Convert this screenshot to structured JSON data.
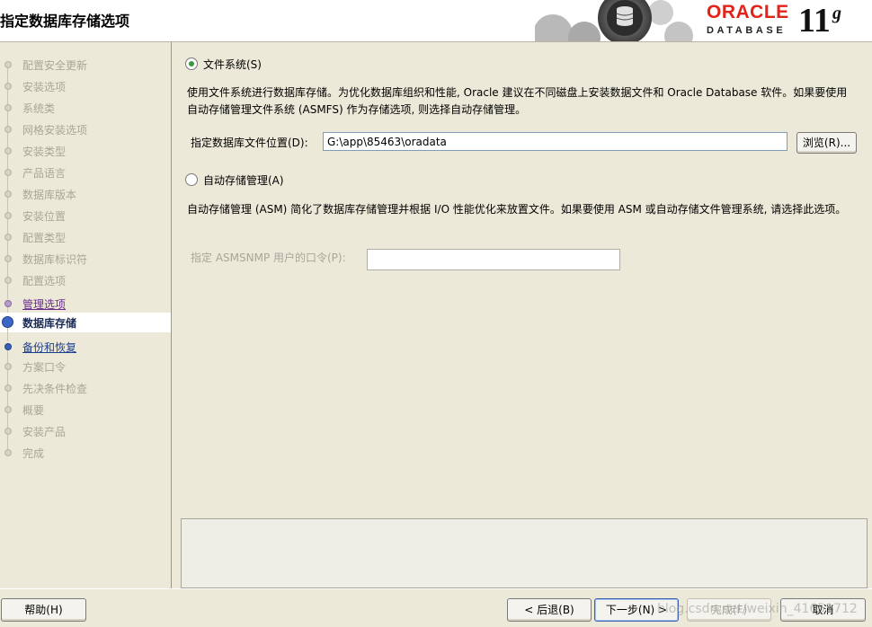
{
  "header": {
    "title": "指定数据库存储选项",
    "logo_oracle": "ORACLE",
    "logo_database": "DATABASE",
    "logo_version": "11",
    "logo_version_sup": "g"
  },
  "nav": {
    "items": [
      {
        "label": "配置安全更新",
        "state": "disabled"
      },
      {
        "label": "安装选项",
        "state": "disabled"
      },
      {
        "label": "系统类",
        "state": "disabled"
      },
      {
        "label": "网格安装选项",
        "state": "disabled"
      },
      {
        "label": "安装类型",
        "state": "disabled"
      },
      {
        "label": "产品语言",
        "state": "disabled"
      },
      {
        "label": "数据库版本",
        "state": "disabled"
      },
      {
        "label": "安装位置",
        "state": "disabled"
      },
      {
        "label": "配置类型",
        "state": "disabled"
      },
      {
        "label": "数据库标识符",
        "state": "disabled"
      },
      {
        "label": "配置选项",
        "state": "disabled"
      },
      {
        "label": "管理选项",
        "state": "visited"
      },
      {
        "label": "数据库存储",
        "state": "current"
      },
      {
        "label": "备份和恢复",
        "state": "link"
      },
      {
        "label": "方案口令",
        "state": "disabled"
      },
      {
        "label": "先决条件检查",
        "state": "disabled"
      },
      {
        "label": "概要",
        "state": "disabled"
      },
      {
        "label": "安装产品",
        "state": "disabled"
      },
      {
        "label": "完成",
        "state": "disabled"
      }
    ]
  },
  "main": {
    "fs_option": {
      "label": "文件系统(S)",
      "checked": true,
      "description": "使用文件系统进行数据库存储。为优化数据库组织和性能, Oracle 建议在不同磁盘上安装数据文件和 Oracle Database 软件。如果要使用自动存储管理文件系统 (ASMFS) 作为存储选项, 则选择自动存储管理。",
      "location_label": "指定数据库文件位置(D):",
      "location_value": "G:\\app\\85463\\oradata",
      "browse_label": "浏览(R)..."
    },
    "asm_option": {
      "label": "自动存储管理(A)",
      "checked": false,
      "description": "自动存储管理 (ASM) 简化了数据库存储管理并根据 I/O 性能优化来放置文件。如果要使用 ASM 或自动存储文件管理系统, 请选择此选项。",
      "password_label": "指定 ASMSNMP 用户的口令(P):",
      "password_value": ""
    }
  },
  "footer": {
    "help_label": "帮助(H)",
    "back_label": "< 后退(B)",
    "next_label": "下一步(N) >",
    "finish_label": "完成(F)",
    "cancel_label": "取消",
    "watermark": "blog.csdn.net/weixin_41651712"
  },
  "colors": {
    "background": "#ece9d8",
    "oracle_red": "#e2231a",
    "visited_link": "#6a2a87",
    "link": "#1d3f8f"
  }
}
